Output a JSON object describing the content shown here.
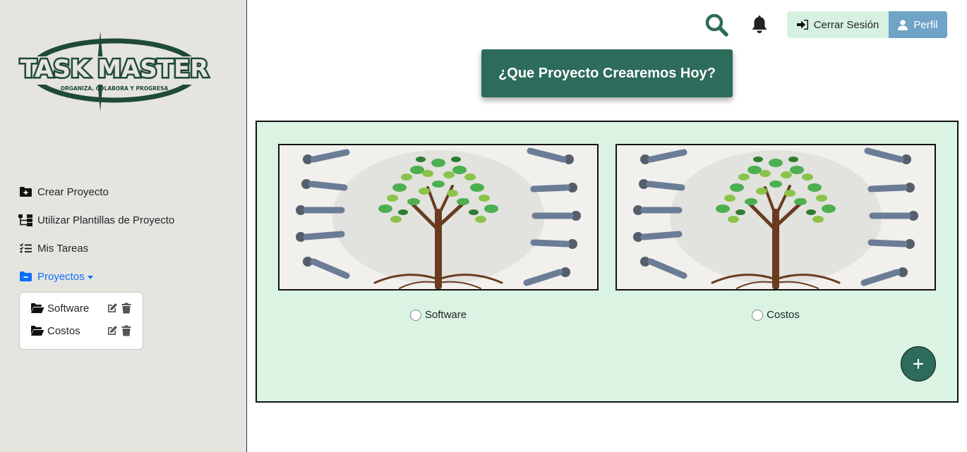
{
  "brand": {
    "logo_title": "TASK MASTER",
    "logo_tagline": "ORGANIZA, COLABORA Y PROGRESA",
    "color_dark_green": "#1f4a38",
    "color_primary": "#2d6b5a"
  },
  "sidebar": {
    "items": [
      {
        "label": "Crear Proyecto",
        "icon": "folder-plus-icon"
      },
      {
        "label": "Utilizar Plantillas de Proyecto",
        "icon": "sitemap-icon"
      },
      {
        "label": "Mis Tareas",
        "icon": "task-list-icon"
      },
      {
        "label": "Proyectos",
        "icon": "folder-minus-icon",
        "active": true
      }
    ],
    "projects": [
      {
        "name": "Software"
      },
      {
        "name": "Costos"
      }
    ]
  },
  "header": {
    "logout_label": "Cerrar Sesión",
    "profile_label": "Perfil",
    "headline": "¿Que Proyecto Crearemos Hoy?"
  },
  "main": {
    "cards": [
      {
        "label": "Software"
      },
      {
        "label": "Costos"
      }
    ],
    "add_button_icon": "plus-icon"
  }
}
